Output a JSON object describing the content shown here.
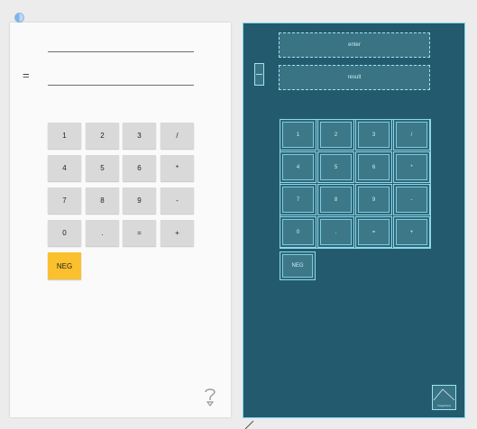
{
  "design": {
    "equals_label": "=",
    "keys": [
      [
        "1",
        "2",
        "3",
        "/"
      ],
      [
        "4",
        "5",
        "6",
        "*"
      ],
      [
        "7",
        "8",
        "9",
        "-"
      ],
      [
        "0",
        ".",
        "=",
        "+"
      ]
    ],
    "neg_label": "NEG",
    "neg_color": "#fbc02d",
    "help_icon": "question-mark-icon"
  },
  "blueprint": {
    "enter_label": "enter",
    "result_label": "result",
    "keys": [
      [
        "1",
        "2",
        "3",
        "/"
      ],
      [
        "4",
        "5",
        "6",
        "*"
      ],
      [
        "7",
        "8",
        "9",
        "-"
      ],
      [
        "0",
        ".",
        "=",
        "+"
      ]
    ],
    "neg_label": "NEG",
    "image_label": "ImageView",
    "background": "#235a6d",
    "outline_color": "#9ee3f5"
  }
}
